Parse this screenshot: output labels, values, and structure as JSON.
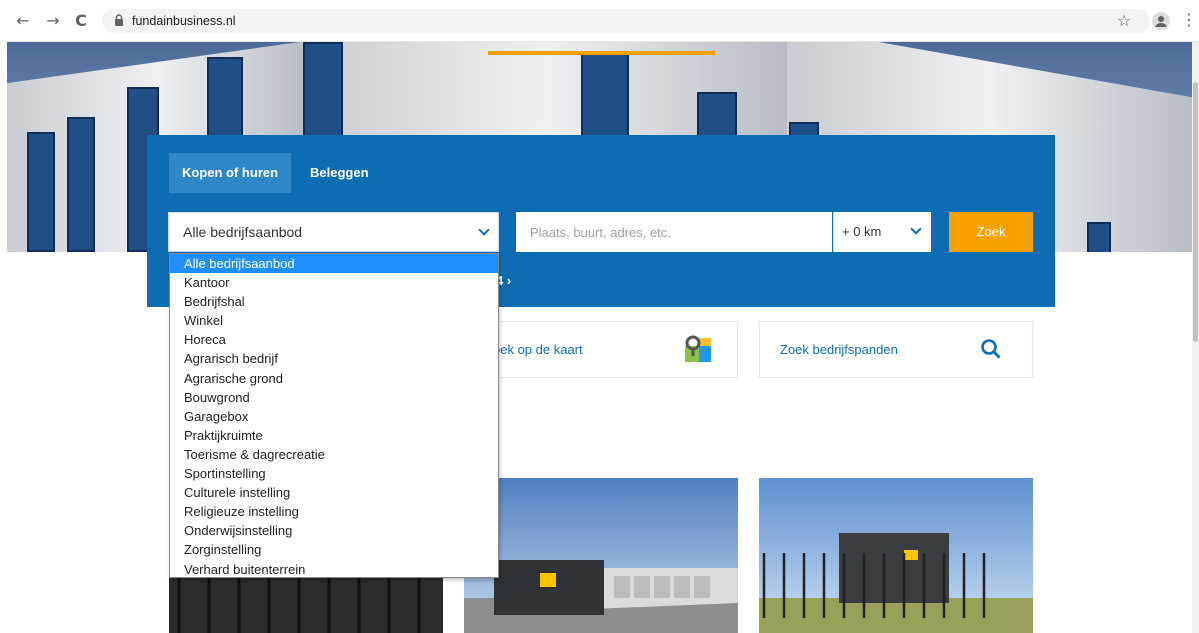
{
  "browser": {
    "url": "fundainbusiness.nl",
    "back_icon": "←",
    "forward_icon": "→",
    "reload_icon": "C",
    "star_icon": "☆",
    "menu_icon": "⋮"
  },
  "search": {
    "tabs": [
      "Kopen of huren",
      "Beleggen"
    ],
    "type_selected": "Alle bedrijfsaanbod",
    "place_placeholder": "Plaats, buurt, adres, etc.",
    "radius": "+ 0 km",
    "submit_label": "Zoek",
    "partial_link": "4 ›",
    "dropdown_options": [
      "Alle bedrijfsaanbod",
      "Kantoor",
      "Bedrijfshal",
      "Winkel",
      "Horeca",
      "Agrarisch bedrijf",
      "Agrarische grond",
      "Bouwgrond",
      "Garagebox",
      "Praktijkruimte",
      "Toerisme & dagrecreatie",
      "Sportinstelling",
      "Culturele instelling",
      "Religieuze instelling",
      "Onderwijsinstelling",
      "Zorginstelling",
      "Verhard buitenterrein"
    ]
  },
  "quicklinks": {
    "map_label": "oek op de kaart",
    "search_label": "Zoek bedrijfspanden"
  },
  "colors": {
    "brand_blue": "#0e6db2",
    "accent_orange": "#f7a100",
    "selected_option": "#1e90ff"
  }
}
